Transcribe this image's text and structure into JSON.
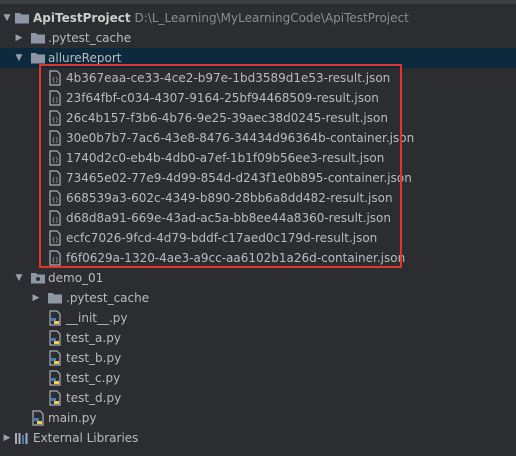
{
  "project": {
    "name": "ApiTestProject",
    "path": "D:\\L_Learning\\MyLearningCode\\ApiTestProject"
  },
  "tree": {
    "pytest_cache_root": ".pytest_cache",
    "allure_folder": "allureReport",
    "allure_files": [
      "4b367eaa-ce33-4ce2-b97e-1bd3589d1e53-result.json",
      "23f64fbf-c034-4307-9164-25bf94468509-result.json",
      "26c4b157-f3b6-4b76-9e25-39aec38d0245-result.json",
      "30e0b7b7-7ac6-43e8-8476-34434d96364b-container.json",
      "1740d2c0-eb4b-4db0-a7ef-1b1f09b56ee3-result.json",
      "73465e02-77e9-4d99-854d-d243f1e0b895-container.json",
      "668539a3-602c-4349-b890-28bb6a8dd482-result.json",
      "d68d8a91-669e-43ad-ac5a-bb8ee44a8360-result.json",
      "ecfc7026-9fcd-4d79-bddf-c17aed0c179d-result.json",
      "f6f0629a-1320-4ae3-a9cc-aa6102b1a26d-container.json"
    ],
    "demo_folder": "demo_01",
    "demo_cache": ".pytest_cache",
    "demo_files": [
      "__init__.py",
      "test_a.py",
      "test_b.py",
      "test_c.py",
      "test_d.py"
    ],
    "main_file": "main.py",
    "external_libraries": "External Libraries"
  },
  "colors": {
    "highlight_border": "#e0352b",
    "selection": "#0d293e",
    "folder": "#8c96a4",
    "python_blue": "#3f7cc4",
    "python_yellow": "#f2c94c"
  },
  "icons": {
    "folder": "folder-icon",
    "json": "json-file-icon",
    "python": "python-file-icon",
    "library": "library-icon"
  }
}
